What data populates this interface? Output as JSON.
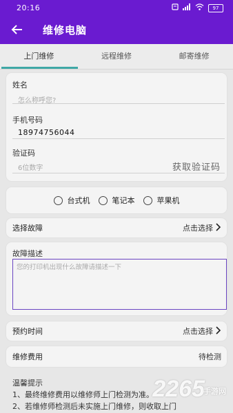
{
  "status_bar": {
    "time": "20:16",
    "battery": "97"
  },
  "app_bar": {
    "title": "维修电脑"
  },
  "tabs": [
    {
      "label": "上门维修",
      "active": true
    },
    {
      "label": "远程维修",
      "active": false
    },
    {
      "label": "邮寄维修",
      "active": false
    }
  ],
  "form": {
    "name_label": "姓名",
    "name_placeholder": "怎么称呼您?",
    "phone_label": "手机号码",
    "phone_value": "18974756044",
    "code_label": "验证码",
    "code_placeholder": "6位数字",
    "get_code": "获取验证码"
  },
  "device_types": [
    "台式机",
    "笔记本",
    "苹果机"
  ],
  "fault": {
    "label": "选择故障",
    "action": "点击选择"
  },
  "description": {
    "label": "故障描述",
    "placeholder": "您的打印机出现什么故障请描述一下"
  },
  "appointment": {
    "label": "预约时间",
    "action": "点击选择"
  },
  "fee": {
    "label": "维修费用",
    "value": "待检测"
  },
  "tips": {
    "title": "温馨提示",
    "line1": "1、最终维修费用以维修师上门检测为准。",
    "line2": "2、若维修师检测后未实施上门维修，则收取上门"
  },
  "watermark": {
    "brand": "2265",
    "suffix": "手游网"
  },
  "colors": {
    "primary": "#6a1bd0",
    "tab_indicator": "#3fa8a6",
    "textarea_border": "#6a44c2"
  }
}
